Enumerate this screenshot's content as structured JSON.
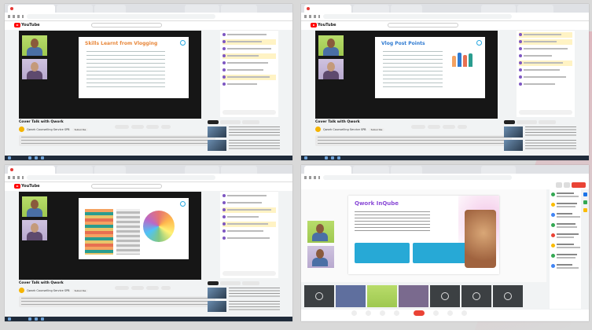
{
  "youtube": {
    "logo_text": "YouTube"
  },
  "quads": [
    {
      "slide_title": "Skills Learnt from Vlogging",
      "video_title": "Cover Talk with Qwork",
      "channel": "Qwork Counselling Service SPB",
      "subscribe": "Subscribe"
    },
    {
      "slide_title": "Vlog Post Points",
      "video_title": "Cover Talk with Qwork",
      "channel": "Qwork Counselling Service SPB",
      "subscribe": "Subscribe"
    },
    {
      "slide_title": "",
      "video_title": "Cover Talk with Qwork",
      "channel": "Qwork Counselling Service SPB",
      "subscribe": "Subscribe"
    }
  ],
  "meet": {
    "slide_title": "Qwork InQube"
  },
  "colors": {
    "youtube_red": "#ff0000",
    "leave_red": "#ea4335",
    "accent_blue": "#1a73e8"
  },
  "icons": [
    "youtube-logo-icon",
    "search-icon",
    "leave-call-icon",
    "mic-icon",
    "camera-icon",
    "chat-icon"
  ]
}
